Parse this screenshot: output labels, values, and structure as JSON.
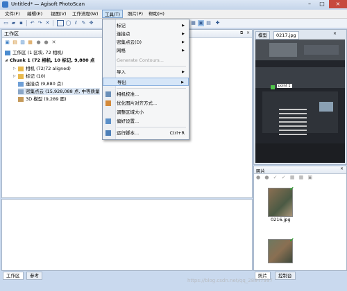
{
  "window": {
    "title": "Untitled* — Agisoft PhotoScan"
  },
  "menubar": [
    "文件(F)",
    "编辑(E)",
    "视图(V)",
    "工作流程(W)",
    "工具(T)",
    "照片(P)",
    "帮助(H)"
  ],
  "tools_menu": {
    "items": [
      {
        "label": "标记",
        "submenu": true
      },
      {
        "label": "连接点",
        "submenu": true
      },
      {
        "label": "密集点云(D)",
        "submenu": true
      },
      {
        "label": "网格",
        "submenu": true
      },
      {
        "label": "Generate Contours...",
        "disabled": true
      },
      {
        "label": "导入",
        "submenu": true
      },
      {
        "label": "导出",
        "submenu": true,
        "highlighted": true
      },
      {
        "label": "相机校准..."
      },
      {
        "label": "优化图片对齐方式..."
      },
      {
        "label": "调整区域大小"
      },
      {
        "label": "偏好设置..."
      },
      {
        "label": "运行脚本...",
        "shortcut": "Ctrl+R"
      }
    ]
  },
  "workspace": {
    "title": "工作区",
    "root": "工作区 (1 区块, 72 相机)",
    "chunk": "Chunk 1 (72 相机, 10 标记, 9,880 点",
    "cameras": "相机 (72/72 aligned)",
    "markers": "标记 (10)",
    "tie_points": "连接点 (9,880 点)",
    "dense_cloud": "密集点云 (15,928,088 点, 中等质量",
    "model": "3D 模型 (9,289 面)"
  },
  "bottom_tabs": [
    "工作区",
    "参考"
  ],
  "model_panel": {
    "tabs": [
      "模型",
      "0217.jpg"
    ],
    "marker_label": "point 1"
  },
  "photos_panel": {
    "title": "照片",
    "thumb_label": "0216.jpg",
    "tabs": [
      "照片",
      "控制台"
    ]
  },
  "watermark": "https://blog.csdn.net/qq_28847997"
}
